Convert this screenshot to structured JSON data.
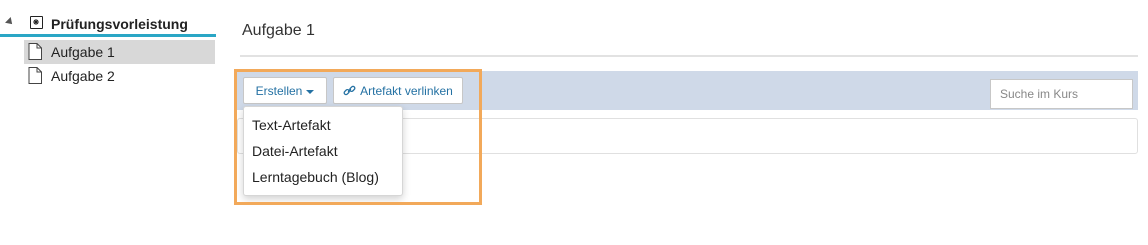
{
  "sidebar": {
    "root_label": "Prüfungsvorleistung",
    "items": [
      {
        "label": "Aufgabe 1",
        "selected": true
      },
      {
        "label": "Aufgabe 2",
        "selected": false
      }
    ]
  },
  "main": {
    "title": "Aufgabe 1",
    "toolbar": {
      "create_label": "Erstellen",
      "link_label": "Artefakt verlinken",
      "search_placeholder": "Suche im Kurs"
    },
    "dropdown": {
      "items": [
        "Text-Artefakt",
        "Datei-Artefakt",
        "Lerntagebuch (Blog)"
      ]
    }
  },
  "colors": {
    "accent": "#2aa6c5",
    "toolbar_bg": "#cfd9e8",
    "link_text": "#2471a3",
    "highlight": "#f2a95a",
    "selected_bg": "#d8d8d8"
  },
  "icons": [
    "expand-triangle-icon",
    "course-node-icon",
    "document-icon",
    "caret-down-icon",
    "link-icon"
  ]
}
